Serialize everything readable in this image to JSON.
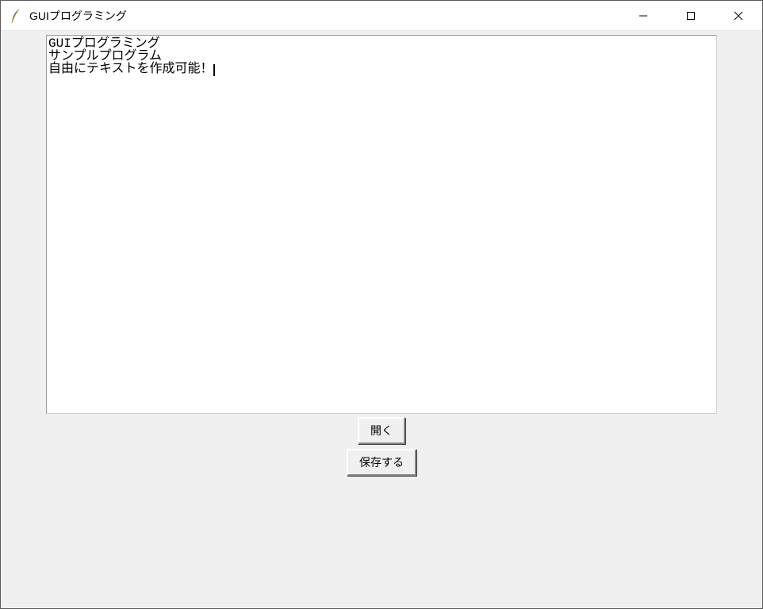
{
  "window": {
    "title": "GUIプログラミング"
  },
  "textarea": {
    "content": "GUIプログラミング\nサンプルプログラム\n自由にテキストを作成可能！"
  },
  "buttons": {
    "open": "開く",
    "save": "保存する"
  }
}
